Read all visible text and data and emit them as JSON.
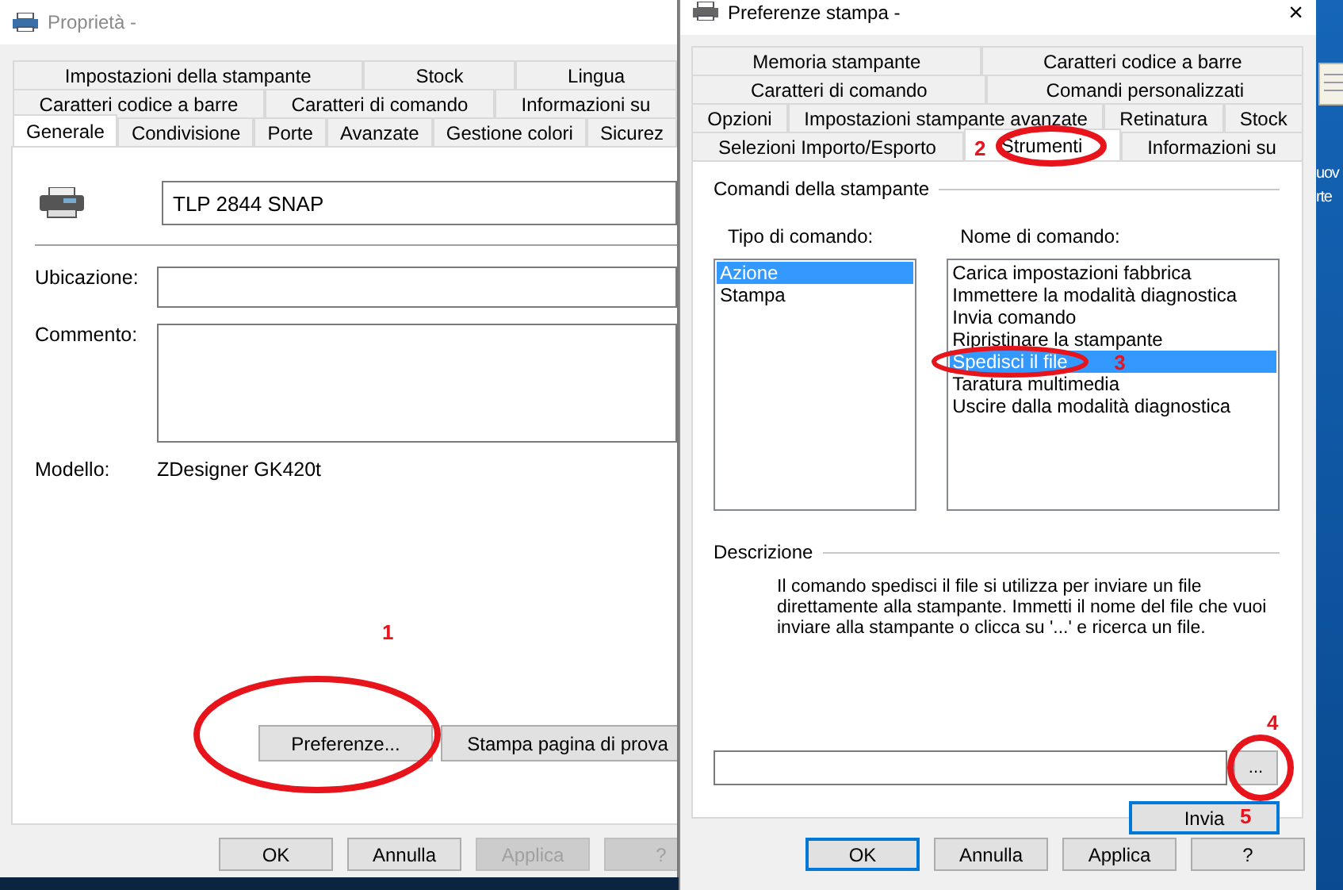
{
  "properties_window": {
    "title": "Proprietà -",
    "tab_rows": [
      [
        {
          "label": "Impostazioni della stampante",
          "selected": false
        },
        {
          "label": "Stock",
          "selected": false
        },
        {
          "label": "Lingua",
          "selected": false
        }
      ],
      [
        {
          "label": "Caratteri codice a barre",
          "selected": false
        },
        {
          "label": "Caratteri di comando",
          "selected": false
        },
        {
          "label": "Informazioni su",
          "selected": false
        }
      ],
      [
        {
          "label": "Generale",
          "selected": true
        },
        {
          "label": "Condivisione",
          "selected": false
        },
        {
          "label": "Porte",
          "selected": false
        },
        {
          "label": "Avanzate",
          "selected": false
        },
        {
          "label": "Gestione colori",
          "selected": false
        },
        {
          "label": "Sicurez",
          "selected": false
        }
      ]
    ],
    "printer_name": "TLP 2844 SNAP",
    "location_label": "Ubicazione:",
    "comment_label": "Commento:",
    "model_label": "Modello:",
    "model_value": "ZDesigner GK420t",
    "buttons": [
      {
        "label": "Preferenze...",
        "annotation": "1",
        "circled": true
      },
      {
        "label": "Stampa pagina di prova"
      }
    ],
    "footer_buttons": [
      {
        "label": "OK",
        "disabled": false
      },
      {
        "label": "Annulla",
        "disabled": false
      },
      {
        "label": "Applica",
        "disabled": true
      },
      {
        "label": "?",
        "disabled": true
      }
    ]
  },
  "preferences_window": {
    "title": "Preferenze stampa -",
    "close": "×",
    "tab_rows": [
      [
        {
          "label": "Memoria stampante",
          "selected": false
        },
        {
          "label": "Caratteri codice a barre",
          "selected": false
        }
      ],
      [
        {
          "label": "Caratteri di comando",
          "selected": false
        },
        {
          "label": "Comandi personalizzati",
          "selected": false
        }
      ],
      [
        {
          "label": "Opzioni",
          "selected": false
        },
        {
          "label": "Impostazioni stampante avanzate",
          "selected": false
        },
        {
          "label": "Retinatura",
          "selected": false
        },
        {
          "label": "Stock",
          "selected": false
        }
      ],
      [
        {
          "label": "Selezioni Importo/Esporto",
          "selected": false
        },
        {
          "label": "Strumenti",
          "selected": true,
          "annotation": "2",
          "circled": true
        },
        {
          "label": "Informazioni su",
          "selected": false
        }
      ]
    ],
    "group_title": "Comandi della stampante",
    "type_label": "Tipo di comando:",
    "types": [
      {
        "label": "Azione",
        "selected": true
      },
      {
        "label": "Stampa",
        "selected": false
      }
    ],
    "name_label": "Nome di comando:",
    "commands": [
      {
        "label": "Carica impostazioni fabbrica",
        "selected": false
      },
      {
        "label": "Immettere la modalità diagnostica",
        "selected": false
      },
      {
        "label": "Invia comando",
        "selected": false
      },
      {
        "label": "Ripristinare la stampante",
        "selected": false
      },
      {
        "label": "Spedisci il file",
        "selected": true,
        "annotation": "3",
        "circled": true
      },
      {
        "label": "Taratura multimedia",
        "selected": false
      },
      {
        "label": "Uscire dalla modalità diagnostica",
        "selected": false
      }
    ],
    "description_title": "Descrizione",
    "description": "Il comando spedisci il file si utilizza per inviare un file direttamente alla stampante. Immetti il nome del file che vuoi inviare alla stampante o clicca su  '...' e ricerca un file.",
    "browse_button": {
      "label": "...",
      "annotation": "4",
      "circled": true
    },
    "send_button": {
      "label": "Invia",
      "focused": true,
      "annotation": "5"
    },
    "footer_buttons": [
      {
        "label": "OK",
        "default": true
      },
      {
        "label": "Annulla",
        "default": false
      },
      {
        "label": "Applica",
        "default": false
      },
      {
        "label": "?",
        "default": false
      }
    ]
  },
  "desktop": {
    "icon_label_lines": [
      "uov",
      "rte"
    ]
  }
}
